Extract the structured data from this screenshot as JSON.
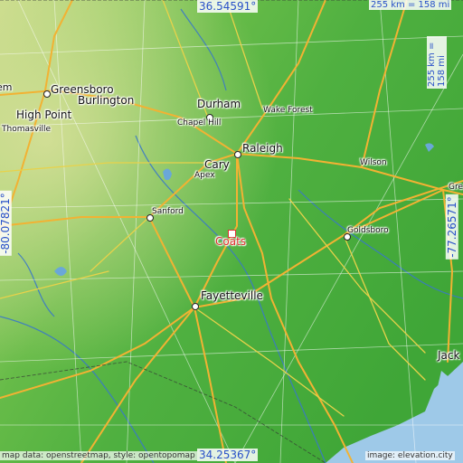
{
  "map": {
    "highlight": {
      "name": "Coats",
      "color": "#e03030"
    },
    "cities": [
      {
        "name": "Greensboro",
        "size": "big"
      },
      {
        "name": "Burlington",
        "size": "big"
      },
      {
        "name": "High Point",
        "size": "big"
      },
      {
        "name": "Thomasville",
        "size": "sm"
      },
      {
        "name": "Durham",
        "size": "big"
      },
      {
        "name": "Chapel Hill",
        "size": "sm"
      },
      {
        "name": "Wake Forest",
        "size": "sm"
      },
      {
        "name": "Raleigh",
        "size": "big"
      },
      {
        "name": "Cary",
        "size": "big"
      },
      {
        "name": "Apex",
        "size": "sm"
      },
      {
        "name": "Wilson",
        "size": "sm"
      },
      {
        "name": "Sanford",
        "size": "sm"
      },
      {
        "name": "Goldsboro",
        "size": "sm"
      },
      {
        "name": "Fayetteville",
        "size": "big"
      },
      {
        "name": "Jack",
        "size": "big"
      },
      {
        "name": "em",
        "size": "big"
      },
      {
        "name": "Gre",
        "size": "sm"
      }
    ],
    "coords": {
      "top": "36.54591°",
      "bottom": "34.25367°",
      "left": "-80.07821°",
      "right": "-77.26571°"
    },
    "scale": {
      "top": "255 km = 158 mi",
      "right": "255 km = 158 mi"
    },
    "footer": {
      "left": "map data: openstreetmap, style: opentopomap",
      "right": "image: elevation.city"
    }
  }
}
